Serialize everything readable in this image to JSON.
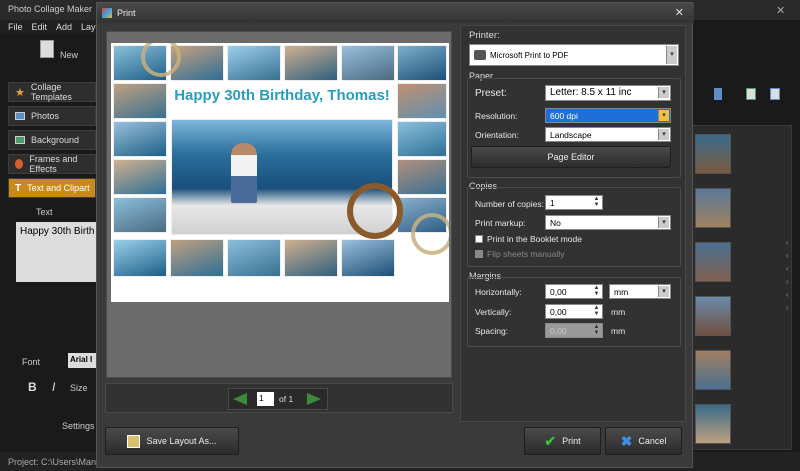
{
  "app": {
    "title": "Photo Collage Maker",
    "menu": [
      "File",
      "Edit",
      "Add",
      "Layer"
    ],
    "toolbar_new": "New",
    "sidebar": [
      {
        "label": "Collage Templates",
        "icon": "star-icon"
      },
      {
        "label": "Photos",
        "icon": "photos-icon"
      },
      {
        "label": "Background",
        "icon": "background-icon"
      },
      {
        "label": "Frames and Effects",
        "icon": "frames-icon"
      },
      {
        "label": "Text and Clipart",
        "icon": "text-icon"
      }
    ],
    "text_section_label": "Text",
    "text_value": "Happy 30th Birth",
    "font_label": "Font",
    "font_value": "Arial I",
    "bold_label": "B",
    "italic_label": "I",
    "size_label": "Size",
    "settings_label": "Settings",
    "status_text": "Project: C:\\Users\\Mana"
  },
  "dialog": {
    "title": "Print",
    "preview_text": "Happy 30th Birthday, Thomas!",
    "page_input": "1",
    "page_of": "of 1",
    "printer": {
      "section_label": "Printer:",
      "value": "Microsoft Print to PDF"
    },
    "paper": {
      "section_label": "Paper",
      "preset_label": "Preset:",
      "preset_value": "Letter: 8.5 x 11 inc",
      "resolution_label": "Resolution:",
      "resolution_value": "600 dpi",
      "orientation_label": "Orientation:",
      "orientation_value": "Landscape",
      "page_editor_button": "Page Editor"
    },
    "copies": {
      "section_label": "Copies",
      "number_label": "Number of copies:",
      "number_value": "1",
      "markup_label": "Print markup:",
      "markup_value": "No",
      "booklet_label": "Print in the Booklet mode",
      "flip_label": "Flip sheets manually"
    },
    "margins": {
      "section_label": "Margins",
      "horizontally_label": "Horizontally:",
      "horizontally_value": "0,00",
      "unit_value": "mm",
      "vertically_label": "Vertically:",
      "vertically_value": "0,00",
      "vertically_unit": "mm",
      "spacing_label": "Spacing:",
      "spacing_value": "0,00",
      "spacing_unit": "mm"
    },
    "buttons": {
      "save_layout": "Save Layout As...",
      "print": "Print",
      "cancel": "Cancel"
    }
  }
}
